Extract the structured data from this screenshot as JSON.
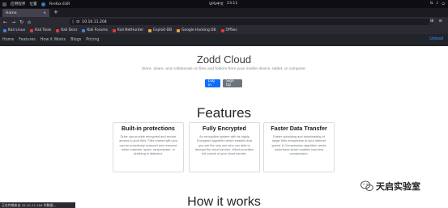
{
  "os_bar": {
    "left_items": [
      "应用程序",
      "位置"
    ],
    "browser_name": "Firefox ESR",
    "center": [
      "VPS中文",
      "23:11"
    ]
  },
  "browser": {
    "tab_title": "Home",
    "url": "10.10.11.204",
    "bookmarks": [
      {
        "label": "Kali Linux",
        "color": "#3b7fd6"
      },
      {
        "label": "Kali Tools",
        "color": "#d83a3a"
      },
      {
        "label": "Kali Docs",
        "color": "#d83a3a"
      },
      {
        "label": "Kali Forums",
        "color": "#3b7fd6"
      },
      {
        "label": "Kali NetHunter",
        "color": "#d83a3a"
      },
      {
        "label": "Exploit-DB",
        "color": "#e6a23c"
      },
      {
        "label": "Google Hacking DB",
        "color": "#e6a23c"
      },
      {
        "label": "OffSec",
        "color": "#d83a3a"
      }
    ],
    "status_text": "正在传输来自 10.10.11.204 的数据..."
  },
  "site": {
    "nav_items": [
      "Home",
      "Features",
      "How it Works",
      "Blogs",
      "Pricing"
    ],
    "upload_label": "Upload",
    "hero": {
      "title": "Zodd Cloud",
      "subtitle": "Store, share, and collaborate on files and folders from your mobile device, tablet, or computer.",
      "login_label": "Log in",
      "signup_label": "Sign Up"
    },
    "features_title": "Features",
    "cards": [
      {
        "title": "Built-in protections",
        "body": "Drive can provide encrypted and secure access to your files. Files shared with you can be proactively scanned and removed when malware, spam, ransomware, or phishing is detected."
      },
      {
        "title": "Fully Encrypted",
        "body": "An encryption system with as highly Encrypted algorithm which enables that you are the only one who can able to decrypt the cloud service. Which provides full control of your cloud service."
      },
      {
        "title": "Faster Data Transfer",
        "body": "Faster uploading and downloading of larger files irrespective of your internet speed. A Compression algorithm works underhood which enables loss less compression."
      }
    ],
    "how_title": "How it works"
  },
  "watermark": {
    "text": "天启实验室"
  },
  "colors": {
    "primary": "#0d6efd",
    "secondary": "#6c757d",
    "navbar": "#212529"
  }
}
